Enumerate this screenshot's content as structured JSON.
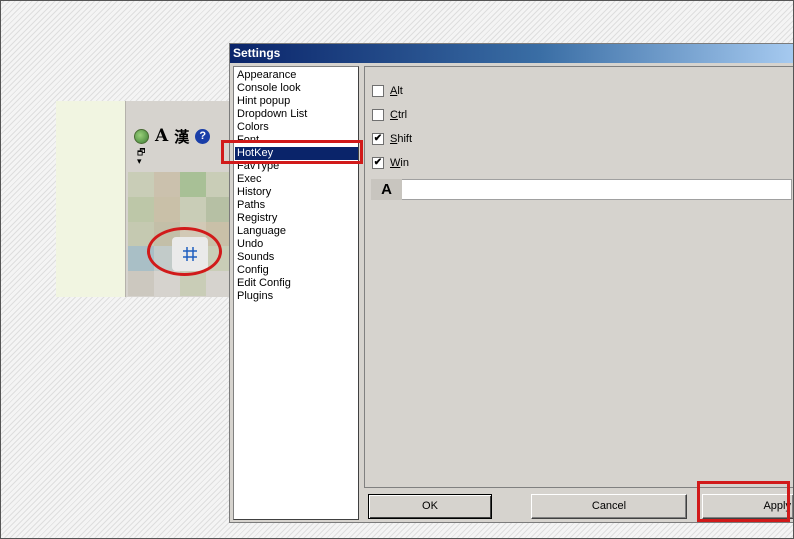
{
  "window": {
    "title": "Settings"
  },
  "nav": {
    "items": [
      {
        "label": "Appearance",
        "selected": false
      },
      {
        "label": "Console look",
        "selected": false
      },
      {
        "label": "Hint popup",
        "selected": false
      },
      {
        "label": "Dropdown List",
        "selected": false
      },
      {
        "label": "Colors",
        "selected": false
      },
      {
        "label": "Font",
        "selected": false
      },
      {
        "label": "HotKey",
        "selected": true
      },
      {
        "label": "FavType",
        "selected": false
      },
      {
        "label": "Exec",
        "selected": false
      },
      {
        "label": "History",
        "selected": false
      },
      {
        "label": "Paths",
        "selected": false
      },
      {
        "label": "Registry",
        "selected": false
      },
      {
        "label": "Language",
        "selected": false
      },
      {
        "label": "Undo",
        "selected": false
      },
      {
        "label": "Sounds",
        "selected": false
      },
      {
        "label": "Config",
        "selected": false
      },
      {
        "label": "Edit Config",
        "selected": false
      },
      {
        "label": "Plugins",
        "selected": false
      }
    ]
  },
  "modifiers": {
    "alt": {
      "label_key": "A",
      "label_rest": "lt",
      "checked": false
    },
    "ctrl": {
      "label_key": "C",
      "label_rest": "trl",
      "checked": false
    },
    "shift": {
      "label_key": "S",
      "label_rest": "hift",
      "checked": true
    },
    "win": {
      "label_key": "W",
      "label_rest": "in",
      "checked": true
    }
  },
  "hotkey": {
    "icon_letter": "A",
    "value": ""
  },
  "buttons": {
    "ok": "OK",
    "cancel": "Cancel",
    "apply": "Apply"
  },
  "checkmark": "✔",
  "background_app": {
    "toolbar_a": "A",
    "toolbar_kanji": "漢",
    "toolbar_help": "?",
    "small_icon": "🗗",
    "dropdown_arrow": "▾",
    "grid_icon": "#"
  },
  "colors": {
    "highlight": "#d11a1a",
    "selection": "#0a246a",
    "title_gradient_start": "#0a246a",
    "title_gradient_end": "#a6caf0",
    "mosaic": [
      "#c9cdb7",
      "#cbc1ad",
      "#a8c096",
      "#c9cdb7",
      "#bdc7a8",
      "#c9c0a8",
      "#c9cdb7",
      "#b6c0a4",
      "#c5c9b1",
      "#c3bfa8",
      "#d2c9b6",
      "#c9c0a8",
      "#a9bfc6",
      "#c2cbc9",
      "#d0cdbd",
      "#c9cdb7",
      "#ccc8bf",
      "#d6d3ce",
      "#c9cdb7",
      "#d6d3ce"
    ]
  }
}
